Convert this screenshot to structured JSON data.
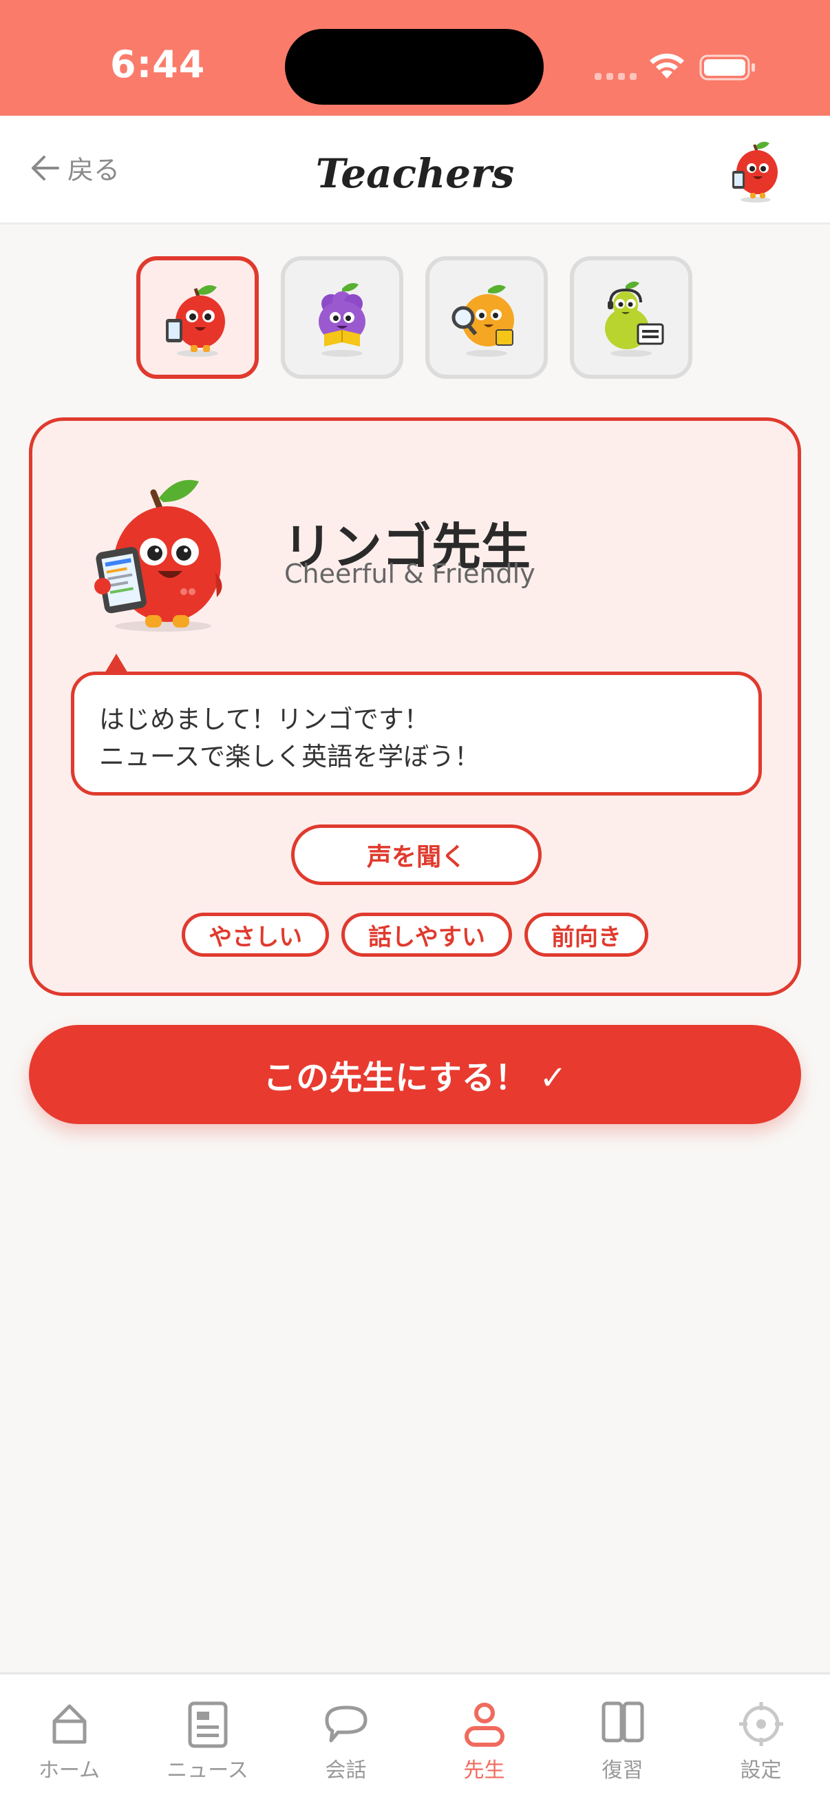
{
  "status_bar": {
    "time": "6:44"
  },
  "header": {
    "back_label": "戻る",
    "title": "Teachers"
  },
  "teachers": [
    {
      "id": "apple",
      "icon": "apple-teacher-icon",
      "selected": true
    },
    {
      "id": "grape",
      "icon": "grape-teacher-icon",
      "selected": false
    },
    {
      "id": "orange",
      "icon": "orange-teacher-icon",
      "selected": false
    },
    {
      "id": "pear",
      "icon": "pear-teacher-icon",
      "selected": false
    }
  ],
  "card": {
    "name": "リンゴ先生",
    "tagline": "Cheerful & Friendly",
    "greeting_line1": "はじめまして！リンゴです！",
    "greeting_line2": "ニュースで楽しく英語を学ぼう！",
    "voice_button": "声を聞く",
    "tags": [
      "やさしい",
      "話しやすい",
      "前向き"
    ]
  },
  "select_button": "この先生にする！ ✓",
  "tab_bar": {
    "tabs": [
      {
        "label": "ホーム",
        "icon": "home-icon",
        "active": false
      },
      {
        "label": "ニュース",
        "icon": "news-icon",
        "active": false
      },
      {
        "label": "会話",
        "icon": "chat-icon",
        "active": false
      },
      {
        "label": "先生",
        "icon": "teacher-icon",
        "active": true
      },
      {
        "label": "復習",
        "icon": "review-book-icon",
        "active": false
      },
      {
        "label": "設定",
        "icon": "settings-icon",
        "active": false
      }
    ]
  },
  "colors": {
    "accent": "#E03A2E",
    "status_bar": "#FA7B6A",
    "card_bg": "#FDEEEC",
    "active_tab": "#F06A5E"
  }
}
